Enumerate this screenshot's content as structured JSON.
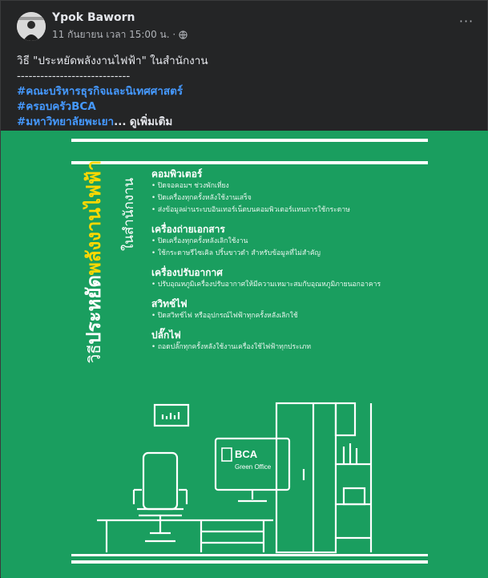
{
  "post": {
    "author": "Ypok Baworn",
    "timestamp": "11 กันยายน เวลา 15:00 น. ·",
    "more_label": "···",
    "text_title": "วิธี \"ประหยัดพลังงานไฟฟ้า\" ในสำนักงาน",
    "separator": "-----------------------------",
    "hashtags": [
      "#คณะบริหารธุรกิจและนิเทศศาสตร์",
      "#ครอบครัวBCA",
      "#มหาวิทยาลัยพะเยา"
    ],
    "ellipsis": "...",
    "see_more": "ดูเพิ่มเติม"
  },
  "image": {
    "title_prefix": "วิธี",
    "title_white": "ประหยัด",
    "title_yellow": "พลังงานไฟฟ้า",
    "title_sub": "ในสำนักงาน",
    "sections": [
      {
        "title": "คอมพิวเตอร์",
        "items": [
          "ปิดจอคอมฯ ช่วงพักเที่ยง",
          "ปิดเครื่องทุกครั้งหลังใช้งานเสร็จ",
          "ส่งข้อมูลผ่านระบบอินเทอร์เน็ตบนคอมพิวเตอร์แทนการใช้กระดาษ"
        ]
      },
      {
        "title": "เครื่องถ่ายเอกสาร",
        "items": [
          "ปิดเครื่องทุกครั้งหลังเลิกใช้งาน",
          "ใช้กระดาษรีไซเคิล ปริ้นขาวดำ สำหรับข้อมูลที่ไม่สำคัญ"
        ]
      },
      {
        "title": "เครื่องปรับอากาศ",
        "items": [
          "ปรับอุณหภูมิเครื่องปรับอากาศให้มีความเหมาะสมกับอุณหภูมิภายนอกอาคาร"
        ]
      },
      {
        "title": "สวิทช์ไฟ",
        "items": [
          "ปิดสวิทช์ไฟ หรืออุปกรณ์ไฟฟ้าทุกครั้งหลังเลิกใช้"
        ]
      },
      {
        "title": "ปลั๊กไฟ",
        "items": [
          "ถอดปลั๊กทุกครั้งหลังใช้งานเครื่องใช้ไฟฟ้าทุกประเภท"
        ]
      }
    ],
    "logo_main": "BCA",
    "logo_sub": "Green Office"
  },
  "colors": {
    "background": "#242526",
    "link": "#4599ff",
    "poster_green": "#1a9e5f",
    "title_yellow": "#ffd800"
  }
}
